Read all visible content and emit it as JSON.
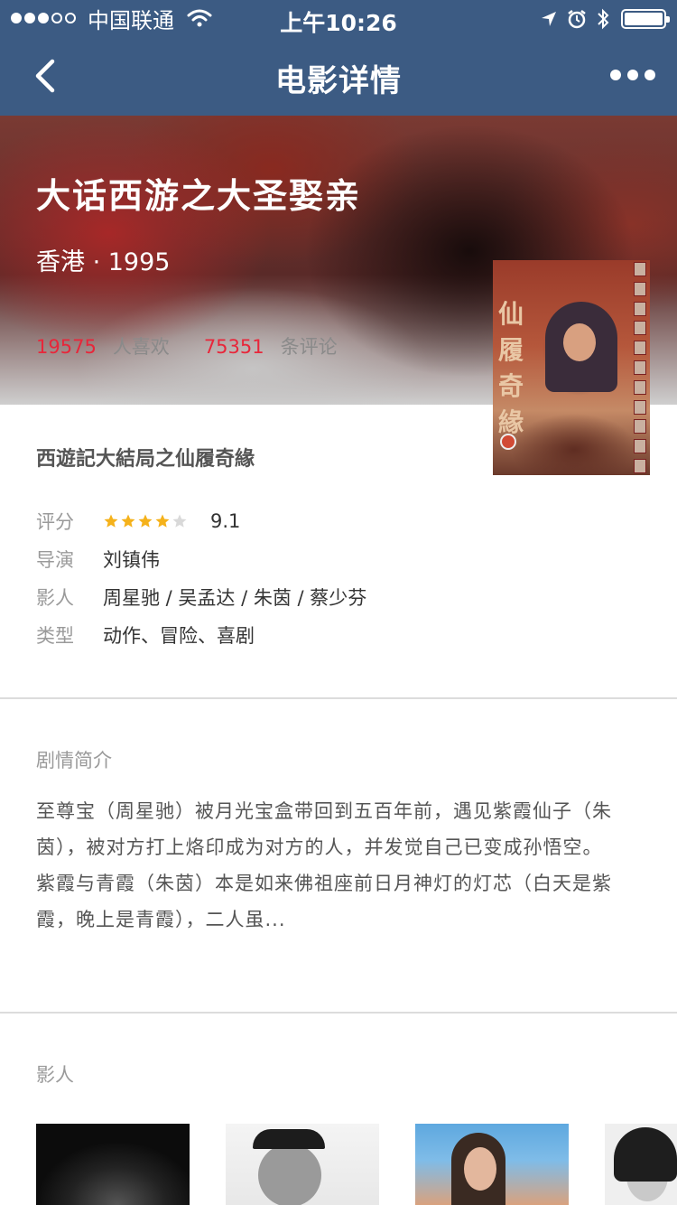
{
  "status_bar": {
    "carrier": "中国联通",
    "time": "上午10:26"
  },
  "nav": {
    "title": "电影详情"
  },
  "movie": {
    "title": "大话西游之大圣娶亲",
    "meta": "香港 · 1995",
    "likes": "19575",
    "likes_label": "人喜欢",
    "comments": "75351",
    "comments_label": "条评论",
    "original_title": "西遊記大結局之仙履奇緣",
    "poster_text": "仙履奇緣"
  },
  "details": {
    "rating_label": "评分",
    "rating_stars": 4,
    "rating_stars_max": 5,
    "rating_value": "9.1",
    "director_label": "导演",
    "director": "刘镇伟",
    "cast_label": "影人",
    "cast": "周星驰 / 吴孟达 / 朱茵 / 蔡少芬",
    "genre_label": "类型",
    "genre": "动作、冒险、喜剧"
  },
  "synopsis": {
    "title": "剧情简介",
    "line1": "至尊宝（周星驰）被月光宝盒带回到五百年前，遇见紫霞仙子（朱茵），被对方打上烙印成为对方的人，并发觉自己已变成孙悟空。",
    "line2": "紫霞与青霞（朱茵）本是如来佛祖座前日月神灯的灯芯（白天是紫霞，晚上是青霞），二人虽..."
  },
  "people_section": {
    "title": "影人"
  },
  "colors": {
    "nav_bg": "#3c5b83",
    "stat_number": "#e8263a",
    "star": "#f5b21b"
  }
}
